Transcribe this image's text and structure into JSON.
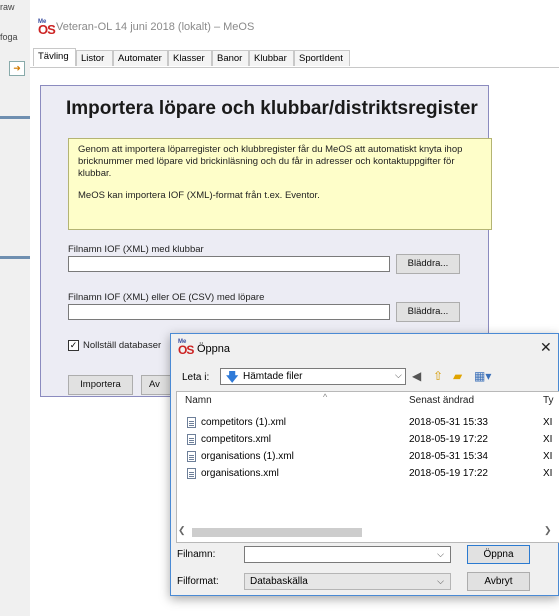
{
  "background_app": {
    "fragments": [
      "raw",
      "foga"
    ]
  },
  "window": {
    "title": "Veteran-OL 14 juni 2018 (lokalt) – MeOS",
    "logo": "OS",
    "logo_sup": "Me"
  },
  "tabs": [
    "Tävling",
    "Listor",
    "Automater",
    "Klasser",
    "Banor",
    "Klubbar",
    "SportIdent"
  ],
  "import_panel": {
    "title": "Importera löpare och klubbar/distriktsregister",
    "info_paragraph_1": "Genom att importera löparregister och klubbregister får du MeOS att automatiskt knyta ihop bricknummer med löpare vid brickinläsning och du får in adresser och kontaktuppgifter för klubbar.",
    "info_paragraph_2": "MeOS kan importera IOF (XML)-format från t.ex. Eventor.",
    "clubs_label": "Filnamn IOF (XML) med klubbar",
    "clubs_value": "",
    "clubs_browse": "Bläddra...",
    "runners_label": "Filnamn IOF (XML) eller OE (CSV) med löpare",
    "runners_value": "",
    "runners_browse": "Bläddra...",
    "reset_checkbox_label": "Nollställ databaser",
    "reset_checked": true,
    "import_button": "Importera",
    "cancel_button_partial": "Av"
  },
  "open_dialog": {
    "title": "Öppna",
    "close": "✕",
    "look_in_label": "Leta i:",
    "look_in_value": "Hämtade filer",
    "columns": {
      "name": "Namn",
      "modified": "Senast ändrad",
      "type": "Ty"
    },
    "files": [
      {
        "name": "competitors (1).xml",
        "modified": "2018-05-31 15:33",
        "type": "XI"
      },
      {
        "name": "competitors.xml",
        "modified": "2018-05-19 17:22",
        "type": "XI"
      },
      {
        "name": "organisations (1).xml",
        "modified": "2018-05-31 15:34",
        "type": "XI"
      },
      {
        "name": "organisations.xml",
        "modified": "2018-05-19 17:22",
        "type": "XI"
      }
    ],
    "filename_label": "Filnamn:",
    "filename_value": "",
    "filetype_label": "Filformat:",
    "filetype_value": "Databaskälla",
    "open_button": "Öppna",
    "cancel_button": "Avbryt"
  }
}
